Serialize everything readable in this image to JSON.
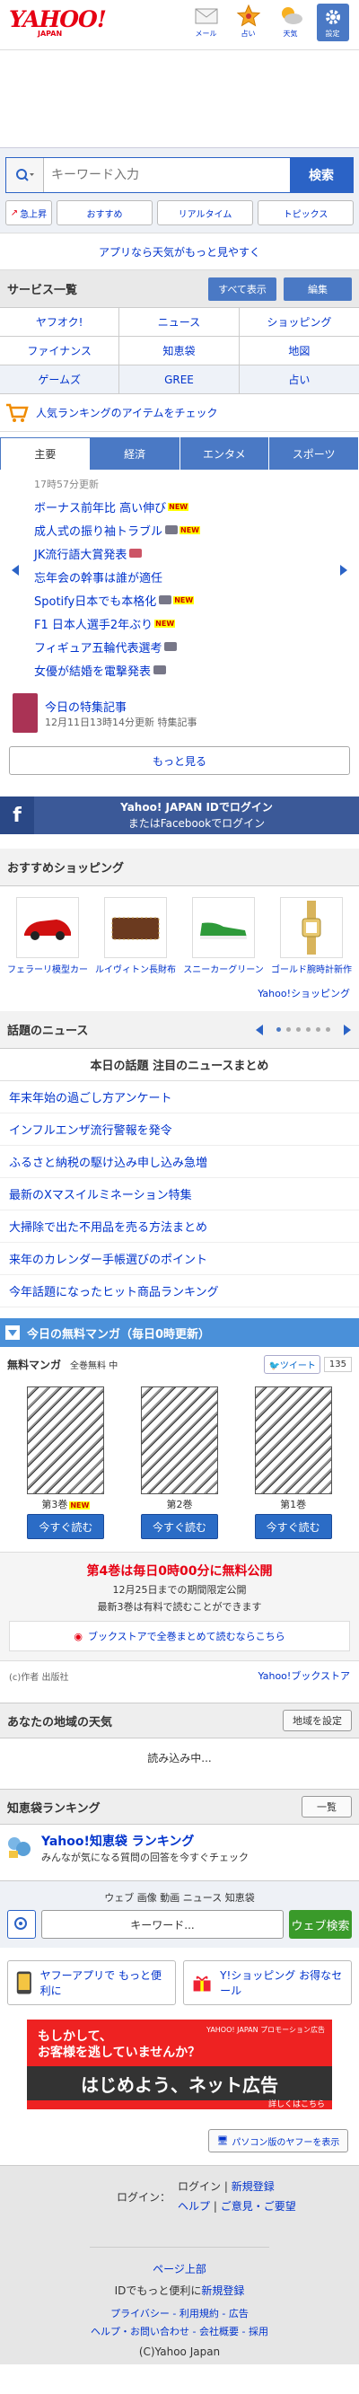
{
  "header": {
    "logo": "YAHOO!",
    "logo_sub": "JAPAN",
    "icons": [
      {
        "name": "mail-icon",
        "label": "メール"
      },
      {
        "name": "star-icon",
        "label": "占い"
      },
      {
        "name": "weather-icon",
        "label": "天気"
      },
      {
        "name": "gear-icon",
        "label": "設定"
      }
    ]
  },
  "search": {
    "placeholder": "キーワード入力",
    "button": "検索",
    "quick": [
      "急上昇",
      "おすすめ",
      "リアルタイム",
      "トピックス"
    ]
  },
  "promo": "アプリなら天気がもっと見やすく",
  "services": {
    "title": "サービス一覧",
    "btn_more": "すべて表示",
    "btn_edit": "編集",
    "items": [
      "ヤフオク!",
      "ニュース",
      "ショッピング",
      "ファイナンス",
      "知恵袋",
      "地図",
      "ゲームズ",
      "GREE",
      "占い"
    ]
  },
  "shopping_banner": "人気ランキングのアイテムをチェック",
  "news": {
    "tabs": [
      "主要",
      "経済",
      "エンタメ",
      "スポーツ"
    ],
    "time": "17時57分更新",
    "items": [
      {
        "text": "ボーナス前年比 高い伸び",
        "cam": false,
        "new": true,
        "vid": false
      },
      {
        "text": "成人式の振り袖トラブル",
        "cam": true,
        "new": true,
        "vid": false
      },
      {
        "text": "JK流行語大賞発表",
        "cam": false,
        "new": false,
        "vid": true
      },
      {
        "text": "忘年会の幹事は誰が適任",
        "cam": false,
        "new": false,
        "vid": false
      },
      {
        "text": "Spotify日本でも本格化",
        "cam": true,
        "new": true,
        "vid": false
      },
      {
        "text": "F1 日本人選手2年ぶり",
        "cam": false,
        "new": true,
        "vid": false
      },
      {
        "text": "フィギュア五輪代表選考",
        "cam": true,
        "new": false,
        "vid": false
      },
      {
        "text": "女優が結婚を電撃発表",
        "cam": true,
        "new": false,
        "vid": false
      }
    ],
    "feature_title": "今日の特集記事",
    "feature_meta": "12月11日13時14分更新 特集記事",
    "more": "もっと見る"
  },
  "fb": {
    "line1": "Yahoo! JAPAN IDでログイン",
    "line2": "またはFacebookでログイン"
  },
  "shop_items": {
    "title": "おすすめショッピング",
    "items": [
      "フェラーリ模型カー",
      "ルイヴィトン長財布",
      "スニーカーグリーン",
      "ゴールド腕時計新作"
    ],
    "link": "Yahoo!ショッピング"
  },
  "topics": {
    "title": "話題のニュース",
    "headline": "本日の話題 注目のニュースまとめ",
    "links": [
      "年末年始の過ごし方アンケート",
      "インフルエンザ流行警報を発令",
      "ふるさと納税の駆け込み申し込み急増",
      "最新のXマスイルミネーション特集",
      "大掃除で出た不用品を売る方法まとめ",
      "来年のカレンダー手帳選びのポイント",
      "今年話題になったヒット商品ランキング"
    ]
  },
  "manga": {
    "header": "今日の無料マンガ（毎日0時更新）",
    "sub1": "無料マンガ",
    "sub2": "全巻無料 中",
    "tweet": "ツイート",
    "count": "135",
    "covers": [
      {
        "label": "第3巻",
        "new": true,
        "btn": "今すぐ読む"
      },
      {
        "label": "第2巻",
        "new": false,
        "btn": "今すぐ読む"
      },
      {
        "label": "第1巻",
        "new": false,
        "btn": "今すぐ読む"
      }
    ],
    "red": "第4巻は毎日0時00分に無料公開",
    "line1": "12月25日までの期間限定公開",
    "line2": "最新3巻は有料で読むことができます",
    "box": "ブックストアで全巻まとめて読むならこちら",
    "copy": "(c)作者 出版社",
    "link": "Yahoo!ブックストア"
  },
  "weather": {
    "title": "あなたの地域の天気",
    "btn": "地域を設定",
    "loading": "読み込み中..."
  },
  "ranking": {
    "title": "知恵袋ランキング",
    "btn": "一覧",
    "logo": "Yahoo!知恵袋 ランキング",
    "sub": "みんなが気になる質問の回答を今すぐチェック"
  },
  "search2": {
    "caption": "ウェブ 画像 動画 ニュース 知恵袋",
    "placeholder": "キーワード...",
    "btn": "ウェブ検索"
  },
  "apps": [
    {
      "text": "ヤフーアプリで もっと便利に"
    },
    {
      "text": "Y!ショッピング お得なセール"
    }
  ],
  "banner": {
    "line1": "もしかして、",
    "line2": "お客様を逃していませんか？",
    "big": "はじめよう、ネット広告",
    "corner": "YAHOO! JAPAN プロモーション広告",
    "more": "詳しくはこちら"
  },
  "pc_link": "パソコン版のヤフーを表示",
  "footer": {
    "login_label": "ログイン：",
    "l1": "ログイン",
    "l2": "新規登録",
    "l3": "ヘルプ",
    "l4": "ご意見・ご要望",
    "top": "ページ上部",
    "id_text": "IDでもっと便利に",
    "id_link": "新規登録",
    "r1": "プライバシー - 利用規約 - 広告",
    "r2": "ヘルプ・お問い合わせ - 会社概要 - 採用",
    "copy": "(C)Yahoo Japan"
  }
}
